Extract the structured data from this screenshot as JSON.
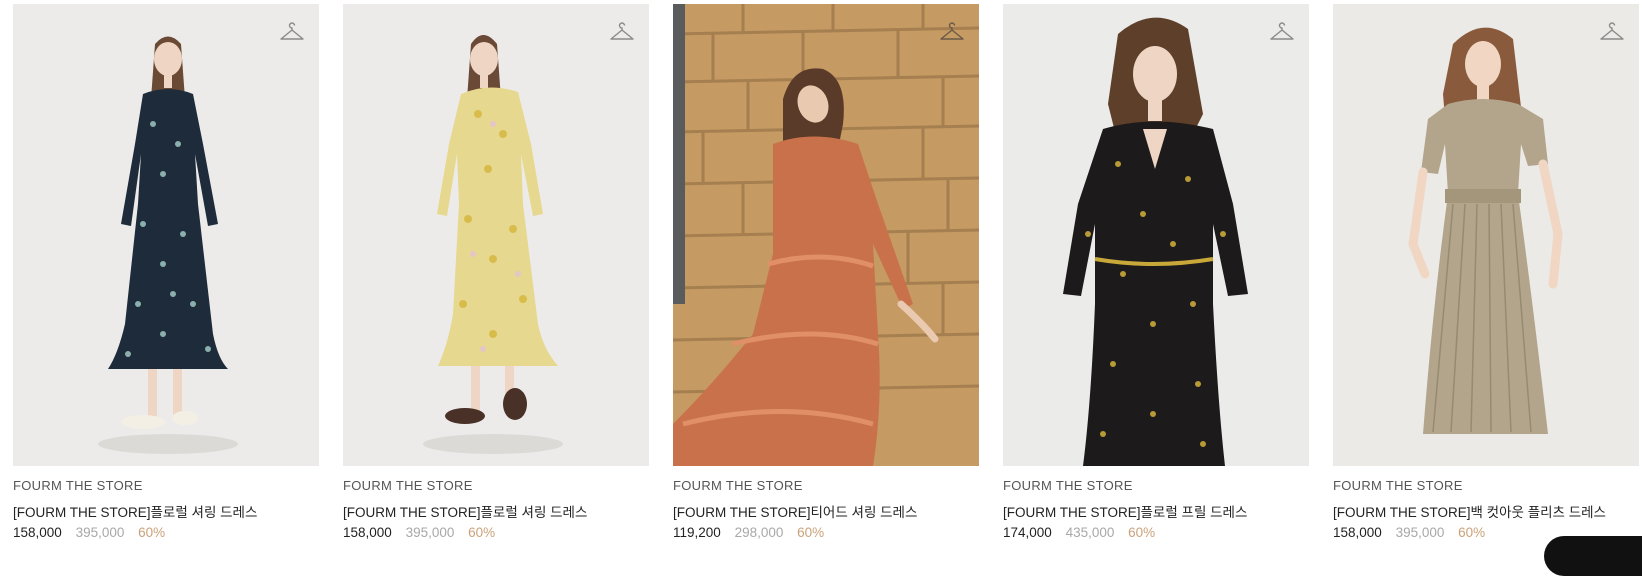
{
  "products": [
    {
      "brand": "FOURM THE STORE",
      "name": "[FOURM THE STORE]플로럴 셔링 드레스",
      "price": "158,000",
      "original_price": "395,000",
      "discount": "60%",
      "icon": "hanger-icon",
      "background": "#ecebea",
      "dress_color": "#1d2b3a"
    },
    {
      "brand": "FOURM THE STORE",
      "name": "[FOURM THE STORE]플로럴 셔링 드레스",
      "price": "158,000",
      "original_price": "395,000",
      "discount": "60%",
      "icon": "hanger-icon",
      "background": "#ecebea",
      "dress_color": "#e7d88f"
    },
    {
      "brand": "FOURM THE STORE",
      "name": "[FOURM THE STORE]티어드 셔링 드레스",
      "price": "119,200",
      "original_price": "298,000",
      "discount": "60%",
      "icon": "hanger-icon",
      "background": "#c59a63",
      "dress_color": "#c9714a"
    },
    {
      "brand": "FOURM THE STORE",
      "name": "[FOURM THE STORE]플로럴 프릴 드레스",
      "price": "174,000",
      "original_price": "435,000",
      "discount": "60%",
      "icon": "hanger-icon",
      "background": "#ebebea",
      "dress_color": "#1c1a1a"
    },
    {
      "brand": "FOURM THE STORE",
      "name": "[FOURM THE STORE]백 컷아웃 플리츠 드레스",
      "price": "158,000",
      "original_price": "395,000",
      "discount": "60%",
      "icon": "hanger-icon",
      "background": "#eceae6",
      "dress_color": "#b2a58b"
    }
  ],
  "colors": {
    "brand_text": "#555555",
    "name_text": "#222222",
    "original_price_text": "#a8a8a8",
    "discount_text": "#c9a27a"
  }
}
